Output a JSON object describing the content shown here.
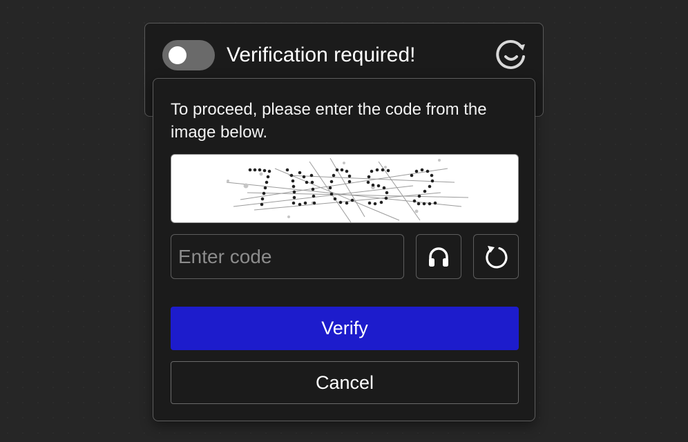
{
  "banner": {
    "title": "Verification required!",
    "toggle_state": "off",
    "brand_icon": "refresh-smile-icon"
  },
  "panel": {
    "prompt": "To proceed, please enter the code from the image below.",
    "captcha_icon": "captcha-image",
    "input": {
      "placeholder": "Enter code",
      "value": ""
    },
    "audio_icon": "headphones-icon",
    "reload_icon": "reload-icon",
    "verify_label": "Verify",
    "cancel_label": "Cancel"
  },
  "colors": {
    "background": "#262626",
    "panel": "#1b1b1b",
    "border": "#5e5e5e",
    "primary": "#1d1ccc",
    "text": "#ffffff"
  }
}
